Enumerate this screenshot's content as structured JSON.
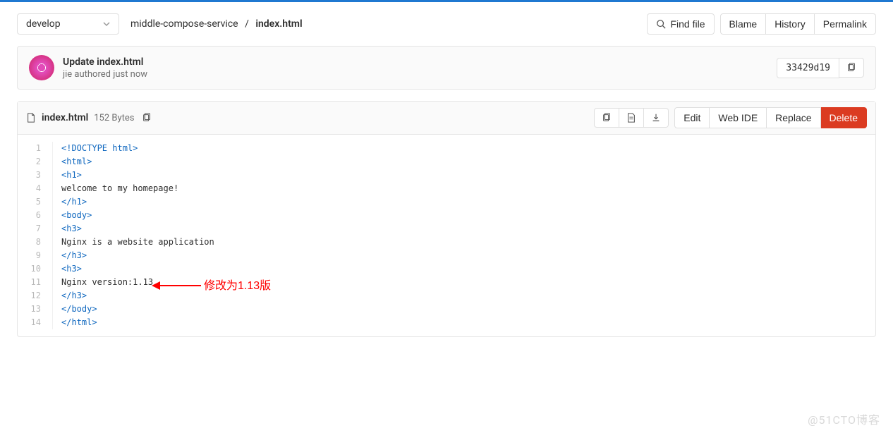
{
  "branch": "develop",
  "breadcrumb": {
    "parent": "middle-compose-service",
    "current": "index.html"
  },
  "buttons": {
    "find_file": "Find file",
    "blame": "Blame",
    "history": "History",
    "permalink": "Permalink",
    "edit": "Edit",
    "web_ide": "Web IDE",
    "replace": "Replace",
    "delete": "Delete"
  },
  "commit": {
    "title": "Update index.html",
    "author": "jie",
    "action": "authored",
    "time": "just now",
    "sha": "33429d19"
  },
  "file": {
    "name": "index.html",
    "size": "152 Bytes"
  },
  "code": {
    "lines": [
      {
        "n": 1,
        "text": "<!DOCTYPE html>",
        "cls": "tag"
      },
      {
        "n": 2,
        "text": "<html>",
        "cls": "tag"
      },
      {
        "n": 3,
        "text": "<h1>",
        "cls": "tag"
      },
      {
        "n": 4,
        "text": "welcome to my homepage!",
        "cls": "plain"
      },
      {
        "n": 5,
        "text": "</h1>",
        "cls": "tag"
      },
      {
        "n": 6,
        "text": "<body>",
        "cls": "tag"
      },
      {
        "n": 7,
        "text": "<h3>",
        "cls": "tag"
      },
      {
        "n": 8,
        "text": "Nginx is a website application",
        "cls": "plain"
      },
      {
        "n": 9,
        "text": "</h3>",
        "cls": "tag"
      },
      {
        "n": 10,
        "text": "<h3>",
        "cls": "tag"
      },
      {
        "n": 11,
        "text": "Nginx version:1.13",
        "cls": "plain"
      },
      {
        "n": 12,
        "text": "</h3>",
        "cls": "tag"
      },
      {
        "n": 13,
        "text": "</body>",
        "cls": "tag"
      },
      {
        "n": 14,
        "text": "</html>",
        "cls": "tag"
      }
    ]
  },
  "annotation": "修改为1.13版",
  "watermark": "@51CTO博客"
}
